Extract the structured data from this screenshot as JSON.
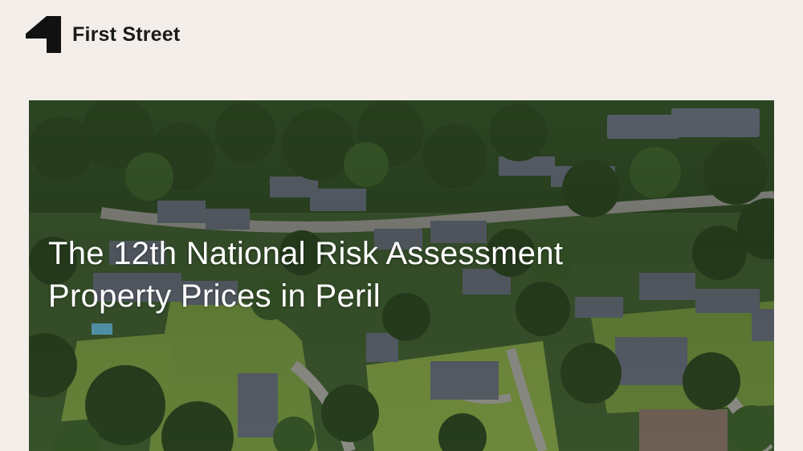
{
  "header": {
    "brand_name": "First Street",
    "logo_icon": "first-street-logo-icon"
  },
  "hero": {
    "image_subject": "aerial-suburban-neighborhood-image",
    "title_line1": "The 12th National Risk Assessment",
    "title_line2": "Property Prices in Peril"
  },
  "colors": {
    "page_background": "#f3eeea",
    "brand_text": "#1a1a1a",
    "hero_title": "#ffffff"
  }
}
